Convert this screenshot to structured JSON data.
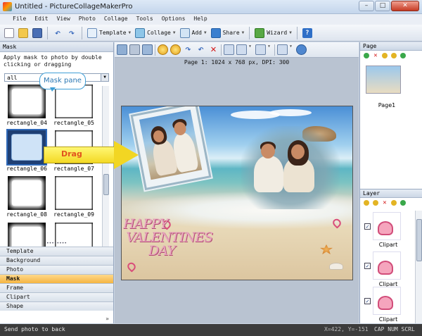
{
  "window": {
    "title": "Untitled - PictureCollageMakerPro",
    "controls": {
      "minimize": "–",
      "maximize": "□",
      "close": "✕"
    }
  },
  "menu": [
    "File",
    "Edit",
    "View",
    "Photo",
    "Collage",
    "Tools",
    "Options",
    "Help"
  ],
  "toolbar": {
    "template_label": "Template",
    "collage_label": "Collage",
    "add_label": "Add",
    "share_label": "Share",
    "wizard_label": "Wizard",
    "help_glyph": "?"
  },
  "left_panel": {
    "header": "Mask",
    "description": "Apply mask to photo by double clicking or dragging",
    "filter_value": "all",
    "thumbnails": [
      {
        "caption": "rectangle_04"
      },
      {
        "caption": "rectangle_05"
      },
      {
        "caption": "rectangle_06"
      },
      {
        "caption": "rectangle_07"
      },
      {
        "caption": "rectangle_08"
      },
      {
        "caption": "rectangle_09"
      }
    ],
    "tabs": [
      "Template",
      "Background",
      "Photo",
      "Mask",
      "Frame",
      "Clipart",
      "Shape"
    ],
    "active_tab": "Mask",
    "more_glyph": "»"
  },
  "canvas": {
    "page_info": "Page 1: 1024 x 768 px, DPI: 300",
    "clipart_text": [
      "HAPPY",
      "VALENTINES",
      "DAY"
    ]
  },
  "annotations": {
    "callout": "Mask pane",
    "arrow": "Drag"
  },
  "right_panel": {
    "page_header": "Page",
    "page_caption": "Page1",
    "layer_header": "Layer",
    "layers": [
      {
        "caption": "Clipart",
        "checked": "✓"
      },
      {
        "caption": "Clipart",
        "checked": "✓"
      },
      {
        "caption": "Clipart",
        "checked": "✓"
      }
    ]
  },
  "status": {
    "message": "Send photo to back",
    "coords": "X=422, Y=-151",
    "keys": "CAP NUM SCRL"
  }
}
